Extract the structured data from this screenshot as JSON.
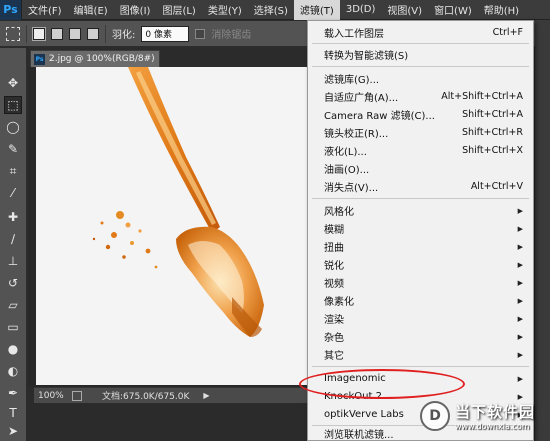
{
  "app": {
    "logo": "Ps"
  },
  "menubar": {
    "items": [
      {
        "label": "文件(F)"
      },
      {
        "label": "编辑(E)"
      },
      {
        "label": "图像(I)"
      },
      {
        "label": "图层(L)"
      },
      {
        "label": "类型(Y)"
      },
      {
        "label": "选择(S)"
      },
      {
        "label": "滤镜(T)"
      },
      {
        "label": "3D(D)"
      },
      {
        "label": "视图(V)"
      },
      {
        "label": "窗口(W)"
      },
      {
        "label": "帮助(H)"
      }
    ]
  },
  "options": {
    "feather_label": "羽化:",
    "feather_value": "0 像素",
    "antialias_label": "消除锯齿"
  },
  "document": {
    "tab_title": "2.jpg @ 100%(RGB/8#)",
    "zoom": "100%",
    "doc_info": "文档:675.0K/675.0K"
  },
  "filter_menu": {
    "items": [
      {
        "label": "载入工作图层",
        "shortcut": "Ctrl+F"
      },
      {
        "label": "转换为智能滤镜(S)",
        "shortcut": ""
      },
      {
        "label": "滤镜库(G)...",
        "shortcut": ""
      },
      {
        "label": "自适应广角(A)...",
        "shortcut": "Alt+Shift+Ctrl+A"
      },
      {
        "label": "Camera Raw 滤镜(C)...",
        "shortcut": "Shift+Ctrl+A"
      },
      {
        "label": "镜头校正(R)...",
        "shortcut": "Shift+Ctrl+R"
      },
      {
        "label": "液化(L)...",
        "shortcut": "Shift+Ctrl+X"
      },
      {
        "label": "油画(O)...",
        "shortcut": ""
      },
      {
        "label": "消失点(V)...",
        "shortcut": "Alt+Ctrl+V"
      },
      {
        "label": "风格化",
        "shortcut": ""
      },
      {
        "label": "模糊",
        "shortcut": ""
      },
      {
        "label": "扭曲",
        "shortcut": ""
      },
      {
        "label": "锐化",
        "shortcut": ""
      },
      {
        "label": "视频",
        "shortcut": ""
      },
      {
        "label": "像素化",
        "shortcut": ""
      },
      {
        "label": "渲染",
        "shortcut": ""
      },
      {
        "label": "杂色",
        "shortcut": ""
      },
      {
        "label": "其它",
        "shortcut": ""
      },
      {
        "label": "Imagenomic",
        "shortcut": ""
      },
      {
        "label": "KnockOut 2",
        "shortcut": ""
      },
      {
        "label": "optikVerve Labs",
        "shortcut": ""
      },
      {
        "label": "浏览联机滤镜...",
        "shortcut": ""
      }
    ]
  },
  "watermark": {
    "logo": "D",
    "name": "当下软件园",
    "url": "www.downxia.com"
  },
  "colors": {
    "annotation_oval": "#e02020",
    "ps_blue": "#31a8ff"
  }
}
